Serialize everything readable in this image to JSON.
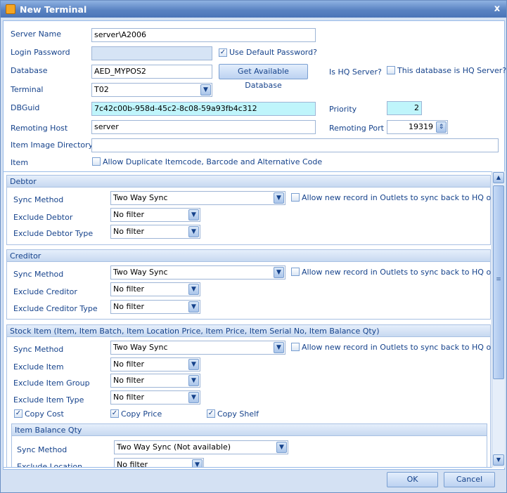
{
  "window": {
    "title": "New Terminal",
    "close_glyph": "x"
  },
  "form": {
    "server_name_label": "Server Name",
    "server_name_value": "server\\A2006",
    "login_password_label": "Login Password",
    "use_default_password_label": "Use Default Password?",
    "use_default_password_checked": true,
    "database_label": "Database",
    "database_value": "AED_MYPOS2",
    "get_db_button": "Get Available Database",
    "is_hq_label": "Is HQ Server?",
    "this_db_hq_label": "This database is HQ Server?",
    "terminal_label": "Terminal",
    "terminal_value": "T02",
    "dbguid_label": "DBGuid",
    "dbguid_value": "7c42c00b-958d-45c2-8c08-59a93fb4c312",
    "priority_label": "Priority",
    "priority_value": "2",
    "remoting_host_label": "Remoting Host",
    "remoting_host_value": "server",
    "remoting_port_label": "Remoting Port",
    "remoting_port_value": "19319",
    "item_image_dir_label": "Item Image Directory",
    "item_image_dir_value": "",
    "item_label": "Item",
    "allow_duplicate_label": "Allow Duplicate Itemcode, Barcode and Alternative Code"
  },
  "debtor": {
    "header": "Debtor",
    "sync_method_label": "Sync Method",
    "sync_method_value": "Two Way Sync",
    "allow_new_label": "Allow new record in Outlets to sync back to HQ only",
    "exclude_label": "Exclude Debtor",
    "exclude_value": "No filter",
    "exclude_type_label": "Exclude Debtor Type",
    "exclude_type_value": "No filter"
  },
  "creditor": {
    "header": "Creditor",
    "sync_method_label": "Sync Method",
    "sync_method_value": "Two Way Sync",
    "allow_new_label": "Allow new record in Outlets to sync back to HQ only",
    "exclude_label": "Exclude Creditor",
    "exclude_value": "No filter",
    "exclude_type_label": "Exclude Creditor Type",
    "exclude_type_value": "No filter"
  },
  "stock": {
    "header": "Stock Item (Item, Item Batch, Item Location Price, Item Price, Item Serial No, Item Balance Qty)",
    "sync_method_label": "Sync Method",
    "sync_method_value": "Two Way Sync",
    "allow_new_label": "Allow new record in Outlets to sync back to HQ only",
    "exclude_item_label": "Exclude Item",
    "exclude_item_value": "No filter",
    "exclude_group_label": "Exclude Item Group",
    "exclude_group_value": "No filter",
    "exclude_type_label": "Exclude Item Type",
    "exclude_type_value": "No filter",
    "copy_cost_label": "Copy Cost",
    "copy_price_label": "Copy Price",
    "copy_shelf_label": "Copy Shelf"
  },
  "balance": {
    "header": "Item Balance Qty",
    "sync_method_label": "Sync Method",
    "sync_method_value": "Two Way Sync (Not available)",
    "exclude_location_label": "Exclude Location",
    "exclude_location_value": "No filter"
  },
  "buttons": {
    "ok": "OK",
    "cancel": "Cancel"
  },
  "glyphs": {
    "check": "✓",
    "arrow_down": "▼",
    "arrow_up": "▲",
    "spin": "⇕",
    "grip": "≡"
  }
}
